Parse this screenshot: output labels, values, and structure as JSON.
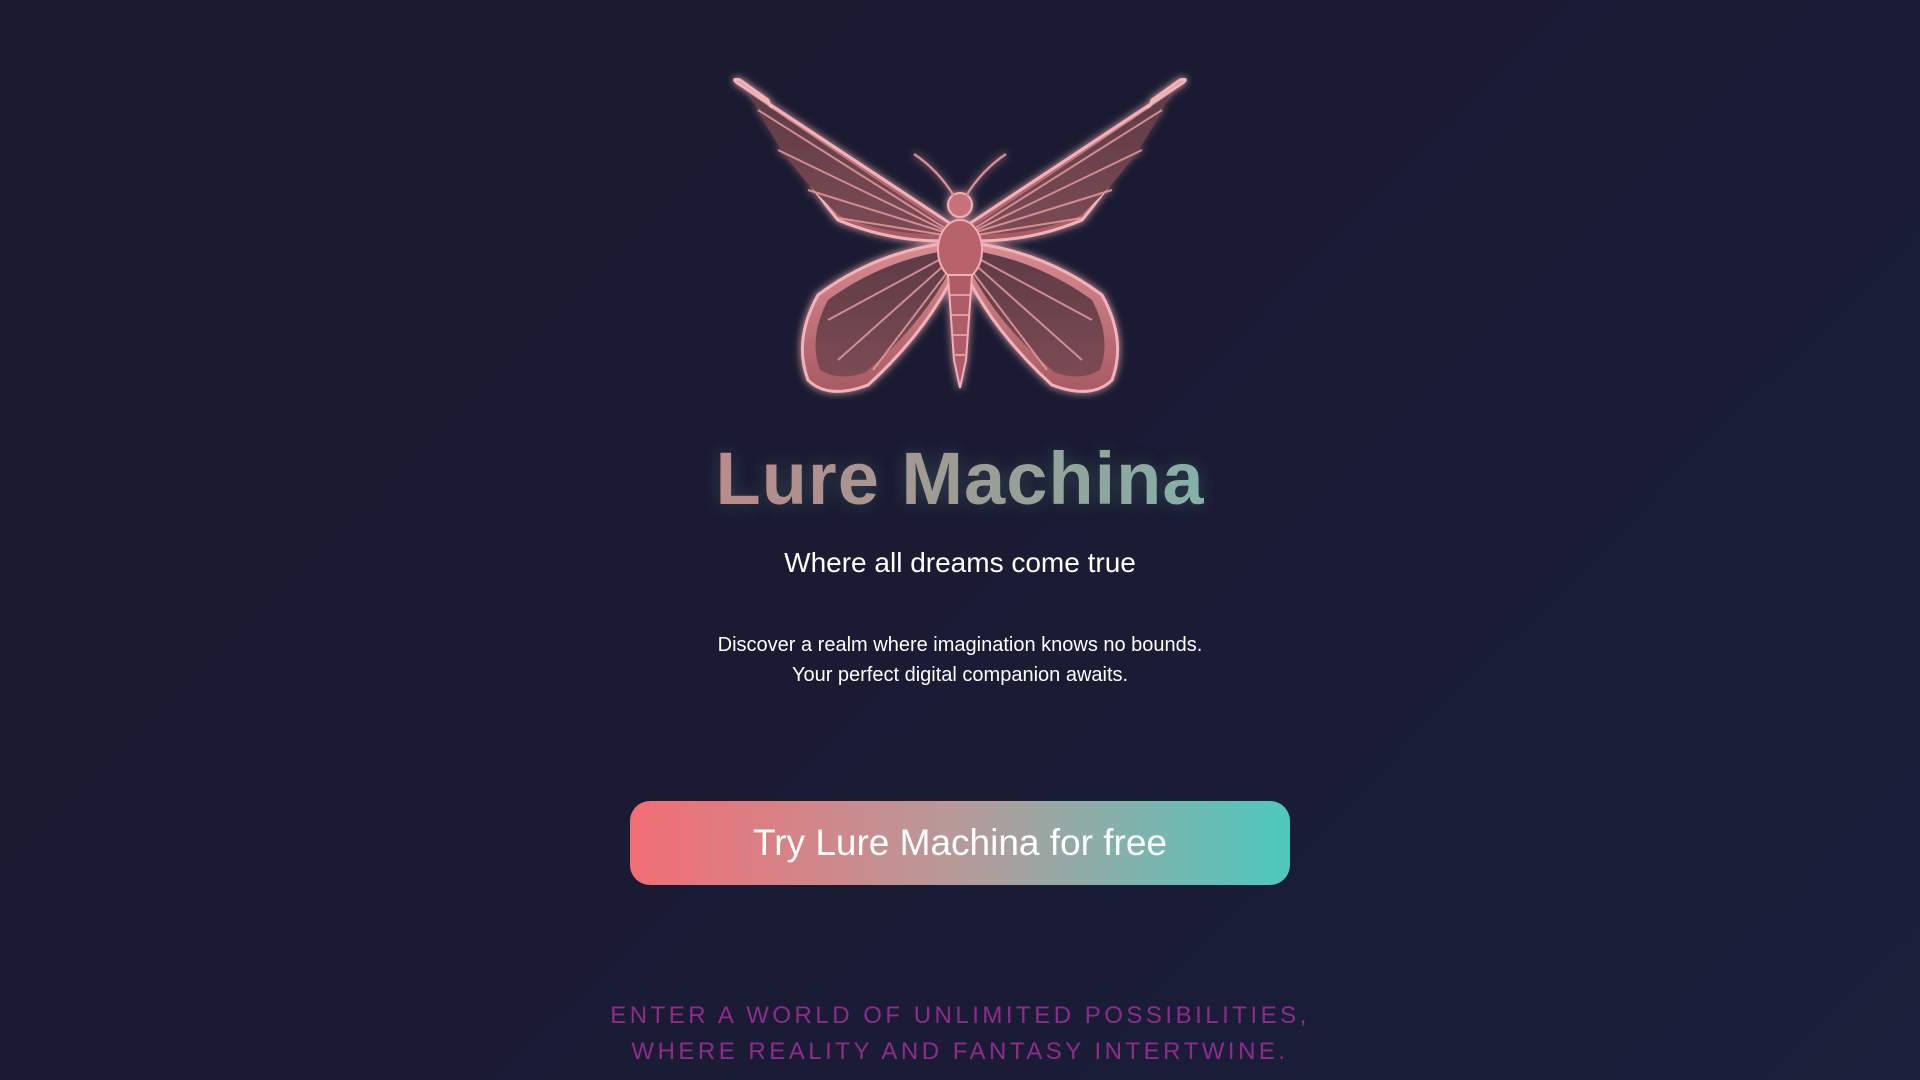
{
  "hero": {
    "logo_icon": "butterfly-icon",
    "title": "Lure Machina",
    "subtitle": "Where all dreams come true",
    "description": [
      "Discover a realm where imagination knows no bounds.",
      "Your perfect digital companion awaits."
    ],
    "cta_label": "Try Lure Machina for free",
    "tagline": [
      "ENTER A WORLD OF UNLIMITED POSSIBILITIES,",
      "WHERE REALITY AND FANTASY INTERTWINE."
    ]
  },
  "colors": {
    "background": "#1b1a2f",
    "accent_pink": "#f26e74",
    "accent_teal": "#4ec9bd",
    "tagline": "#8f2b8d"
  }
}
